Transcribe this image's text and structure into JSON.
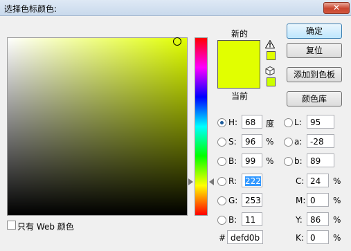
{
  "window": {
    "title": "选择色标颜色:",
    "close_symbol": "✕"
  },
  "colors": {
    "new": "#e1ff00",
    "current": "#e1ff00",
    "websafe": "#ccff00",
    "warning": "#e1ff00"
  },
  "swatch": {
    "new_label": "新的",
    "current_label": "当前"
  },
  "buttons": {
    "ok": "确定",
    "reset": "复位",
    "add_to_swatches": "添加到色板",
    "color_libraries": "颜色库"
  },
  "hsb": {
    "h": {
      "label": "H:",
      "value": "68",
      "unit": "度"
    },
    "s": {
      "label": "S:",
      "value": "96",
      "unit": "%"
    },
    "b": {
      "label": "B:",
      "value": "99",
      "unit": "%"
    }
  },
  "rgb": {
    "r": {
      "label": "R:",
      "value": "222"
    },
    "g": {
      "label": "G:",
      "value": "253"
    },
    "b": {
      "label": "B:",
      "value": "11"
    }
  },
  "lab": {
    "l": {
      "label": "L:",
      "value": "95"
    },
    "a": {
      "label": "a:",
      "value": "-28"
    },
    "b": {
      "label": "b:",
      "value": "89"
    }
  },
  "cmyk": {
    "c": {
      "label": "C:",
      "value": "24",
      "unit": "%"
    },
    "m": {
      "label": "M:",
      "value": "0",
      "unit": "%"
    },
    "y": {
      "label": "Y:",
      "value": "86",
      "unit": "%"
    },
    "k": {
      "label": "K:",
      "value": "0",
      "unit": "%"
    }
  },
  "hex": {
    "label": "#",
    "value": "defd0b"
  },
  "websafe_only": {
    "label": "只有 Web 颜色",
    "checked": false
  },
  "icons": {
    "warning": "gamut-warning-icon",
    "cube": "websafe-cube-icon"
  }
}
